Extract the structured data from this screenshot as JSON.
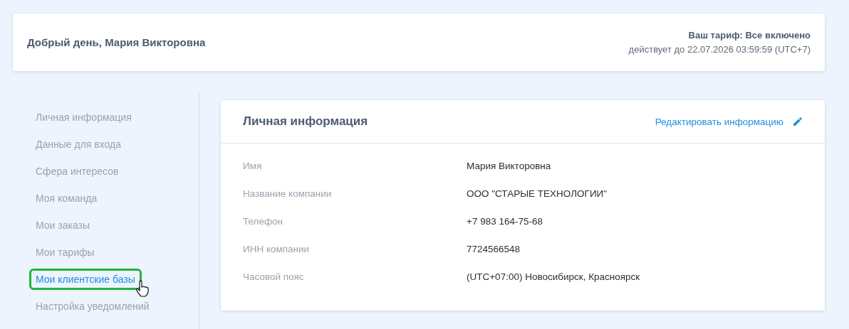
{
  "header": {
    "greeting": "Добрый день, Мария Викторовна",
    "plan": "Ваш тариф: Все включено",
    "valid_until": "действует до 22.07.2026 03:59:59 (UTC+7)"
  },
  "sidebar": {
    "items": [
      {
        "label": "Личная информация",
        "selected": false,
        "highlighted": false
      },
      {
        "label": "Данные для входа",
        "selected": false,
        "highlighted": false
      },
      {
        "label": "Сфера интересов",
        "selected": false,
        "highlighted": false
      },
      {
        "label": "Моя команда",
        "selected": false,
        "highlighted": false
      },
      {
        "label": "Мои заказы",
        "selected": false,
        "highlighted": false
      },
      {
        "label": "Мои тарифы",
        "selected": false,
        "highlighted": false
      },
      {
        "label": "Мои клиентские базы",
        "selected": true,
        "highlighted": true
      },
      {
        "label": "Настройка уведомлений",
        "selected": false,
        "highlighted": false
      }
    ]
  },
  "card": {
    "title": "Личная информация",
    "edit_link": "Редактировать информацию",
    "fields": [
      {
        "label": "Имя",
        "value": "Мария Викторовна"
      },
      {
        "label": "Название компании",
        "value": "ООО \"СТАРЫЕ ТЕХНОЛОГИИ\""
      },
      {
        "label": "Телефон",
        "value": "+7 983 164-75-68"
      },
      {
        "label": "ИНН компании",
        "value": "7724566548"
      },
      {
        "label": "Часовой пояс",
        "value": "(UTC+07:00) Новосибирск, Красноярск"
      }
    ]
  }
}
